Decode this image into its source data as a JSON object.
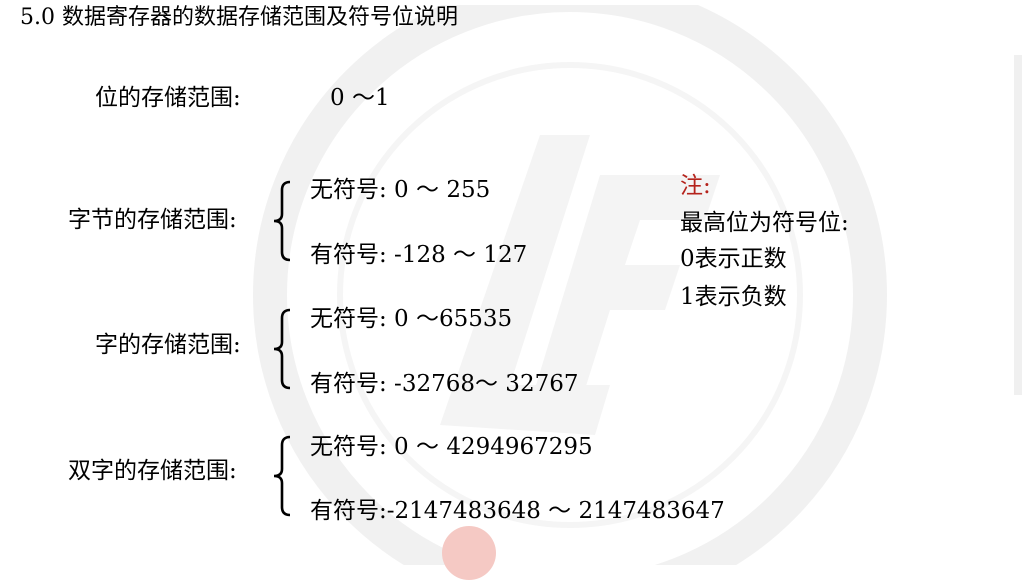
{
  "title": "5.0 数据寄存器的数据存储范围及符号位说明",
  "bit": {
    "label": "位的存储范围:",
    "range": "0 ～1"
  },
  "byte": {
    "label": "字节的存储范围:",
    "unsigned": "无符号: 0 ～ 255",
    "signed": "有符号: -128 ～ 127"
  },
  "word": {
    "label": "字的存储范围:",
    "unsigned": "无符号: 0 ～65535",
    "signed": "有符号: -32768～ 32767"
  },
  "dword": {
    "label": "双字的存储范围:",
    "unsigned": "无符号: 0 ～ 4294967295",
    "signed": "有符号:-2147483648 ～ 2147483647"
  },
  "note": {
    "title": "注:",
    "lines": [
      "最高位为符号位:",
      "0表示正数",
      "1表示负数"
    ]
  },
  "colors": {
    "note_title": "#b5231c",
    "watermark": "#f1f1f1"
  }
}
